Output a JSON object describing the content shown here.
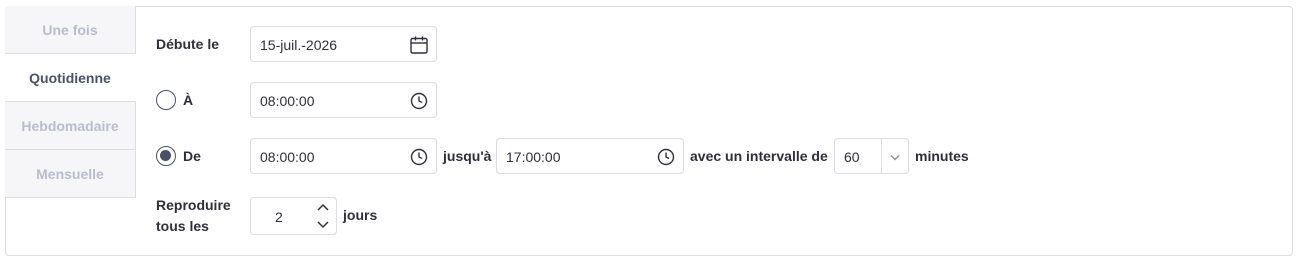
{
  "tabs": [
    {
      "label": "Une fois",
      "active": false
    },
    {
      "label": "Quotidienne",
      "active": true
    },
    {
      "label": "Hebdomadaire",
      "active": false
    },
    {
      "label": "Mensuelle",
      "active": false
    }
  ],
  "start": {
    "label": "Débute le",
    "date": "15-juil.-2026",
    "icon": "calendar-icon"
  },
  "at": {
    "label": "À",
    "selected": false,
    "time": "08:00:00",
    "icon": "clock-icon"
  },
  "from": {
    "label": "De",
    "selected": true,
    "start_time": "08:00:00",
    "until_label": "jusqu'à",
    "end_time": "17:00:00",
    "interval_label": "avec un intervalle de",
    "interval_value": "60",
    "unit_label": "minutes"
  },
  "repeat": {
    "label_line1": "Reproduire",
    "label_line2": "tous les",
    "value": "2",
    "unit_label": "jours"
  },
  "colors": {
    "accent": "#4b5068",
    "border": "#dcdde3",
    "tab_inactive_text": "#b9bccb"
  }
}
